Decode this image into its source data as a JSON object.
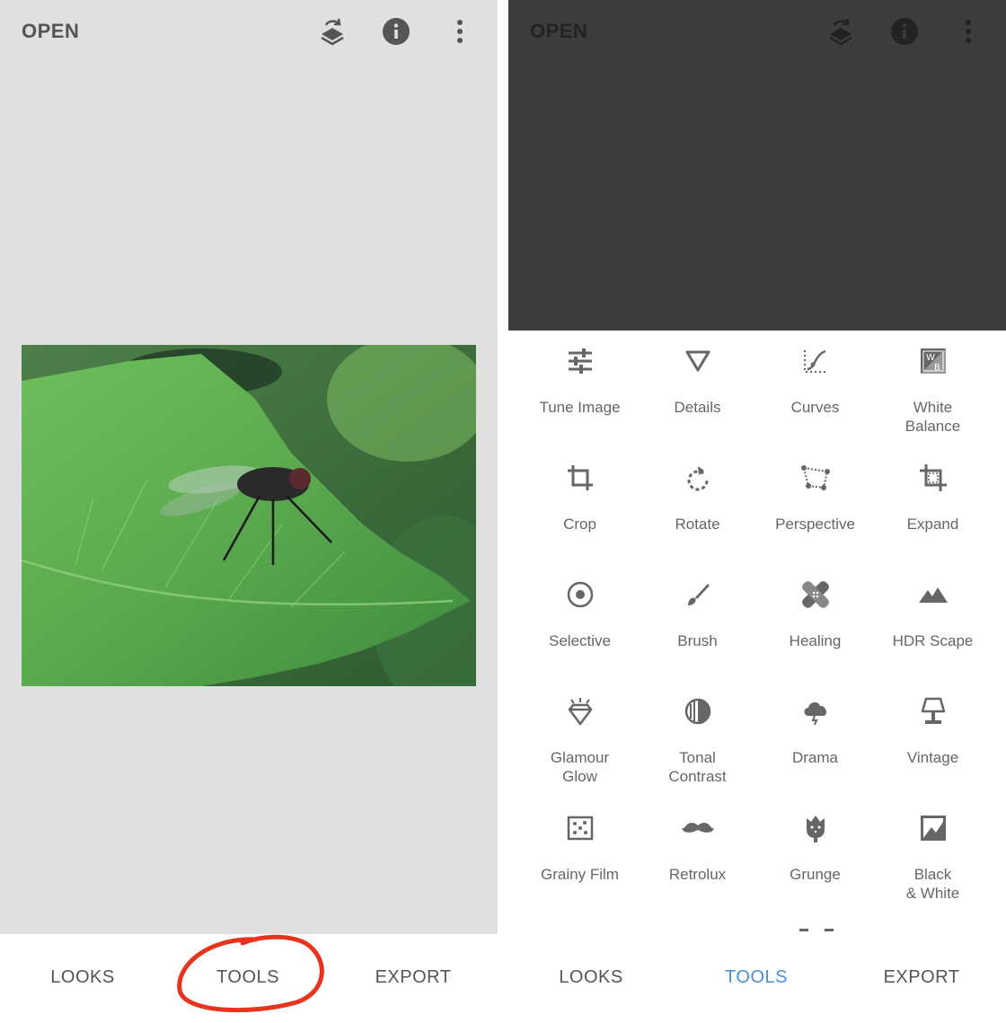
{
  "left": {
    "header": {
      "open_label": "OPEN"
    },
    "nav": {
      "looks": "LOOKS",
      "tools": "TOOLS",
      "export": "EXPORT"
    }
  },
  "right": {
    "header": {
      "open_label": "OPEN"
    },
    "nav": {
      "looks": "LOOKS",
      "tools": "TOOLS",
      "export": "EXPORT"
    },
    "tools": [
      {
        "label": "Tune Image",
        "icon": "tune-icon"
      },
      {
        "label": "Details",
        "icon": "details-triangle-icon"
      },
      {
        "label": "Curves",
        "icon": "curves-icon"
      },
      {
        "label": "White\nBalance",
        "icon": "white-balance-icon"
      },
      {
        "label": "Crop",
        "icon": "crop-icon"
      },
      {
        "label": "Rotate",
        "icon": "rotate-icon"
      },
      {
        "label": "Perspective",
        "icon": "perspective-icon"
      },
      {
        "label": "Expand",
        "icon": "expand-icon"
      },
      {
        "label": "Selective",
        "icon": "selective-target-icon"
      },
      {
        "label": "Brush",
        "icon": "brush-icon"
      },
      {
        "label": "Healing",
        "icon": "healing-bandage-icon"
      },
      {
        "label": "HDR Scape",
        "icon": "mountain-icon"
      },
      {
        "label": "Glamour\nGlow",
        "icon": "diamond-glow-icon"
      },
      {
        "label": "Tonal\nContrast",
        "icon": "tonal-contrast-icon"
      },
      {
        "label": "Drama",
        "icon": "storm-cloud-icon"
      },
      {
        "label": "Vintage",
        "icon": "lamp-icon"
      },
      {
        "label": "Grainy Film",
        "icon": "grain-dots-icon"
      },
      {
        "label": "Retrolux",
        "icon": "mustache-icon"
      },
      {
        "label": "Grunge",
        "icon": "grunge-icon"
      },
      {
        "label": "Black\n& White",
        "icon": "black-white-icon"
      }
    ]
  },
  "colors": {
    "left_bg": "#e0e0e0",
    "right_dark": "#3c3c3c",
    "active_tab": "#4a8fd9",
    "nav_text": "#555555",
    "annotation": "#e8331f"
  }
}
